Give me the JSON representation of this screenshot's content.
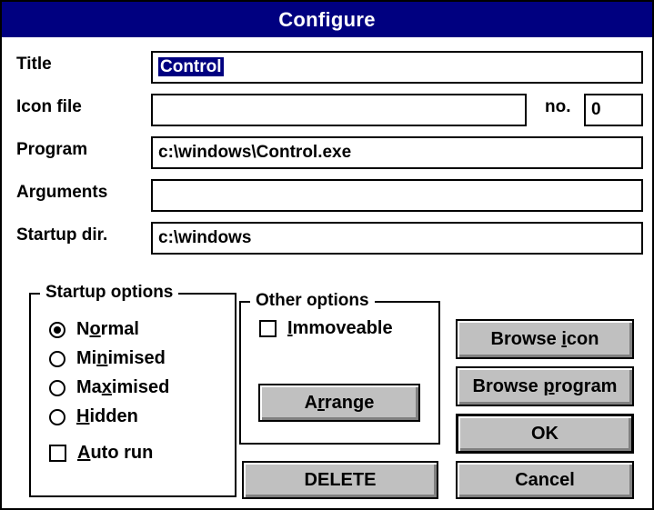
{
  "window": {
    "title": "Configure"
  },
  "fields": {
    "title": {
      "label": "Title",
      "value": "Control"
    },
    "icon_file": {
      "label": "Icon file",
      "value": "",
      "no_label": "no.",
      "no_value": "0"
    },
    "program": {
      "label": "Program",
      "value": "c:\\windows\\Control.exe"
    },
    "arguments": {
      "label": "Arguments",
      "value": ""
    },
    "startup_dir": {
      "label": "Startup dir.",
      "value": "c:\\windows"
    }
  },
  "startup_options": {
    "title": "Startup options",
    "selected": "Normal",
    "items": [
      {
        "pre": "N",
        "mn": "o",
        "post": "rmal",
        "checked": true
      },
      {
        "pre": "Mi",
        "mn": "n",
        "post": "imised",
        "checked": false
      },
      {
        "pre": "Ma",
        "mn": "x",
        "post": "imised",
        "checked": false
      },
      {
        "pre": "",
        "mn": "H",
        "post": "idden",
        "checked": false
      }
    ],
    "auto_run": {
      "pre": "",
      "mn": "A",
      "post": "uto run",
      "checked": false
    }
  },
  "other_options": {
    "title": "Other options",
    "immoveable": {
      "pre": "",
      "mn": "I",
      "post": "mmoveable",
      "checked": false
    },
    "arrange": {
      "pre": "A",
      "mn": "r",
      "post": "range"
    }
  },
  "buttons": {
    "browse_icon": {
      "pre": "Browse ",
      "mn": "i",
      "post": "con"
    },
    "browse_program": {
      "pre": "Browse ",
      "mn": "p",
      "post": "rogram"
    },
    "ok": "OK",
    "cancel": "Cancel",
    "delete": "DELETE"
  }
}
